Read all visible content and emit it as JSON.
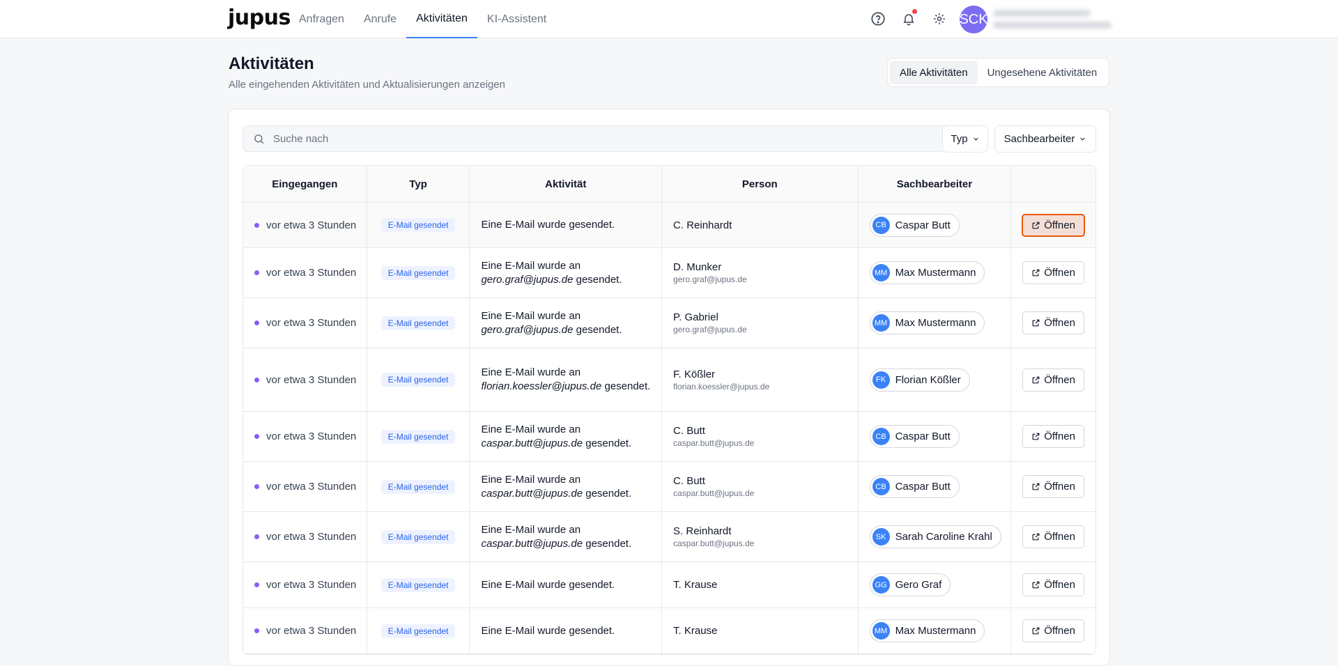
{
  "brand": {
    "logo": "jupus"
  },
  "nav": {
    "items": [
      {
        "label": "Anfragen"
      },
      {
        "label": "Anrufe"
      },
      {
        "label": "Aktivitäten"
      },
      {
        "label": "KI-Assistent"
      }
    ],
    "active": "Aktivitäten"
  },
  "user": {
    "initials": "SCK"
  },
  "header": {
    "title": "Aktivitäten",
    "subtitle": "Alle eingehenden Aktivitäten und Aktualisierungen anzeigen",
    "toggle_all": "Alle Aktivitäten",
    "toggle_unseen": "Ungesehene Aktivitäten"
  },
  "search": {
    "placeholder": "Suche nach"
  },
  "filters": {
    "type": "Typ",
    "handler": "Sachbearbeiter"
  },
  "table": {
    "headers": [
      "Eingegangen",
      "Typ",
      "Aktivität",
      "Person",
      "Sachbearbeiter",
      ""
    ],
    "open_label": "Öffnen",
    "rows": [
      {
        "received": "vor etwa 3 Stunden",
        "type": "E-Mail gesendet",
        "act_pre": "Eine E-Mail wurde gesendet.",
        "act_mail": "",
        "act_post": "",
        "person": "C. Reinhardt",
        "person_email": "",
        "handler_initials": "CB",
        "handler": "Caspar Butt"
      },
      {
        "received": "vor etwa 3 Stunden",
        "type": "E-Mail gesendet",
        "act_pre": "Eine E-Mail wurde an ",
        "act_mail": "gero.graf@jupus.de",
        "act_post": " gesendet.",
        "person": "D. Munker",
        "person_email": "gero.graf@jupus.de",
        "handler_initials": "MM",
        "handler": "Max Mustermann"
      },
      {
        "received": "vor etwa 3 Stunden",
        "type": "E-Mail gesendet",
        "act_pre": "Eine E-Mail wurde an ",
        "act_mail": "gero.graf@jupus.de",
        "act_post": " gesendet.",
        "person": "P. Gabriel",
        "person_email": "gero.graf@jupus.de",
        "handler_initials": "MM",
        "handler": "Max Mustermann"
      },
      {
        "received": "vor etwa 3 Stunden",
        "type": "E-Mail gesendet",
        "act_pre": "Eine E-Mail wurde an ",
        "act_mail": "florian.koessler@jupus.de",
        "act_post": " gesendet.",
        "person": "F. Kößler",
        "person_email": "florian.koessler@jupus.de",
        "handler_initials": "FK",
        "handler": "Florian Kößler"
      },
      {
        "received": "vor etwa 3 Stunden",
        "type": "E-Mail gesendet",
        "act_pre": "Eine E-Mail wurde an ",
        "act_mail": "caspar.butt@jupus.de",
        "act_post": " gesendet.",
        "person": "C. Butt",
        "person_email": "caspar.butt@jupus.de",
        "handler_initials": "CB",
        "handler": "Caspar Butt"
      },
      {
        "received": "vor etwa 3 Stunden",
        "type": "E-Mail gesendet",
        "act_pre": "Eine E-Mail wurde an ",
        "act_mail": "caspar.butt@jupus.de",
        "act_post": " gesendet.",
        "person": "C. Butt",
        "person_email": "caspar.butt@jupus.de",
        "handler_initials": "CB",
        "handler": "Caspar Butt"
      },
      {
        "received": "vor etwa 3 Stunden",
        "type": "E-Mail gesendet",
        "act_pre": "Eine E-Mail wurde an ",
        "act_mail": "caspar.butt@jupus.de",
        "act_post": " gesendet.",
        "person": "S. Reinhardt",
        "person_email": "caspar.butt@jupus.de",
        "handler_initials": "SK",
        "handler": "Sarah Caroline Krahl"
      },
      {
        "received": "vor etwa 3 Stunden",
        "type": "E-Mail gesendet",
        "act_pre": "Eine E-Mail wurde gesendet.",
        "act_mail": "",
        "act_post": "",
        "person": "T. Krause",
        "person_email": "",
        "handler_initials": "GG",
        "handler": "Gero Graf"
      },
      {
        "received": "vor etwa 3 Stunden",
        "type": "E-Mail gesendet",
        "act_pre": "Eine E-Mail wurde gesendet.",
        "act_mail": "",
        "act_post": "",
        "person": "T. Krause",
        "person_email": "",
        "handler_initials": "MM",
        "handler": "Max Mustermann"
      }
    ]
  },
  "colors": {
    "accent": "#3b82f6",
    "unread_dot": "#8b5cf6",
    "focus": "#ea580c",
    "avatar": "#7c6cf2"
  }
}
